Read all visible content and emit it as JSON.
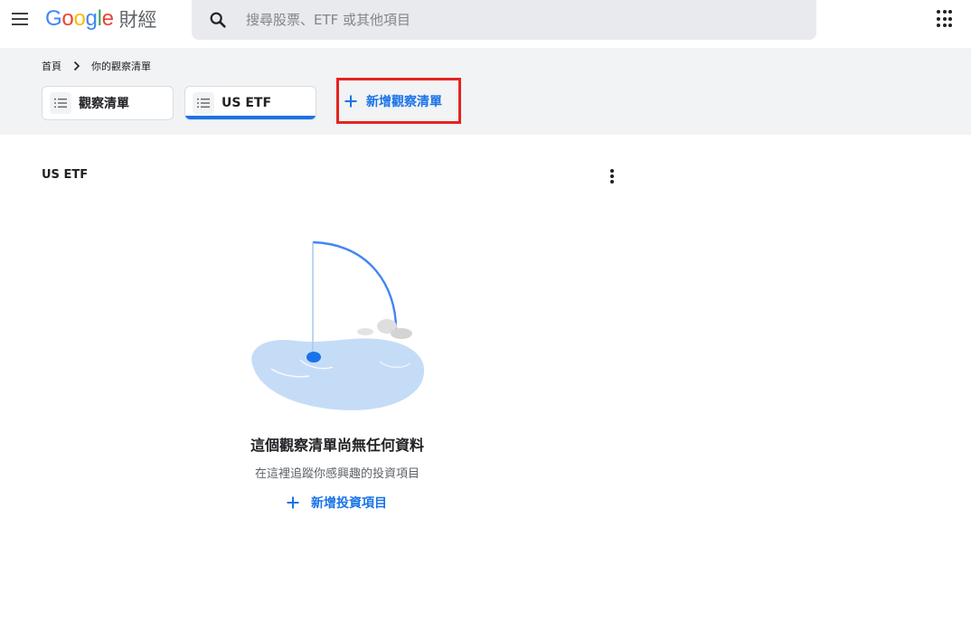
{
  "header": {
    "logo_letters": [
      "G",
      "o",
      "o",
      "g",
      "l",
      "e"
    ],
    "logo_colors": [
      "#4285F4",
      "#EA4335",
      "#FBBC05",
      "#4285F4",
      "#34A853",
      "#EA4335"
    ],
    "product": "財經",
    "search_placeholder": "搜尋股票、ETF 或其他項目"
  },
  "breadcrumb": {
    "home": "首頁",
    "current": "你的觀察清單"
  },
  "tabs": [
    {
      "label": "觀察清單",
      "active": false
    },
    {
      "label": "US ETF",
      "active": true
    }
  ],
  "new_watchlist_label": "新增觀察清單",
  "main": {
    "list_title": "US ETF",
    "empty_title": "這個觀察清單尚無任何資料",
    "empty_subtitle": "在這裡追蹤你感興趣的投資項目",
    "add_investment_label": "新增投資項目"
  },
  "colors": {
    "accent": "#1a73e8",
    "highlight_box": "#e52320",
    "band_bg": "#f1f3f4",
    "search_bg": "#e8eaed"
  },
  "icons": [
    "menu-icon",
    "search-icon",
    "apps-icon",
    "chevron-right-icon",
    "list-icon",
    "plus-icon",
    "more-vert-icon"
  ]
}
